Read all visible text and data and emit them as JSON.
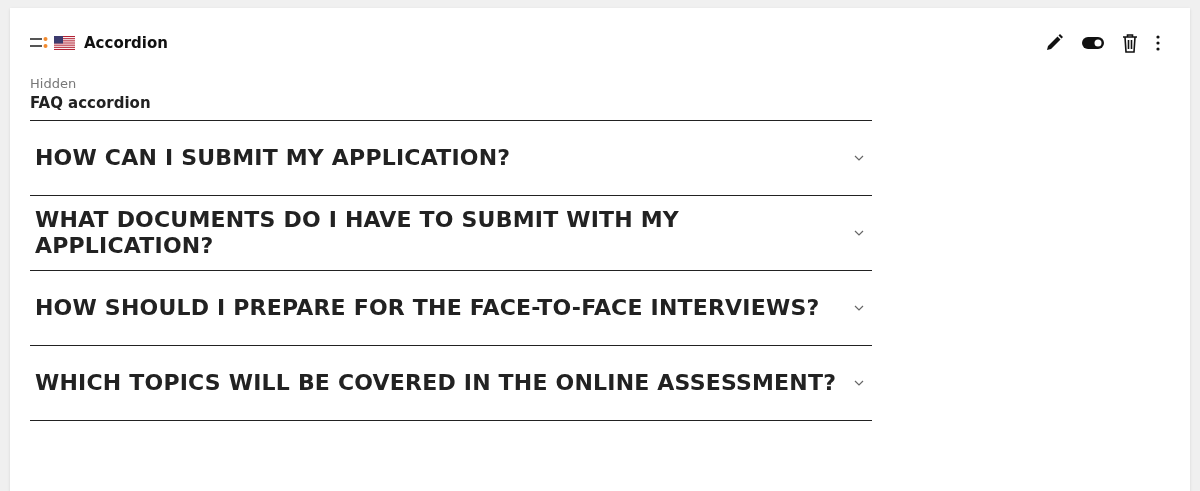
{
  "header": {
    "title": "Accordion"
  },
  "subtitle_label": "Hidden",
  "subtitle": "FAQ accordion",
  "items": [
    {
      "question": "HOW CAN I SUBMIT MY APPLICATION?",
      "expanded": false
    },
    {
      "question": "WHAT DOCUMENTS DO I HAVE TO SUBMIT WITH MY APPLICATION?",
      "expanded": false
    },
    {
      "question": "HOW SHOULD I PREPARE FOR THE FACE-TO-FACE INTERVIEWS?",
      "expanded": false
    },
    {
      "question": "WHICH TOPICS WILL BE COVERED IN THE ONLINE ASSESSMENT?",
      "expanded": false
    }
  ]
}
